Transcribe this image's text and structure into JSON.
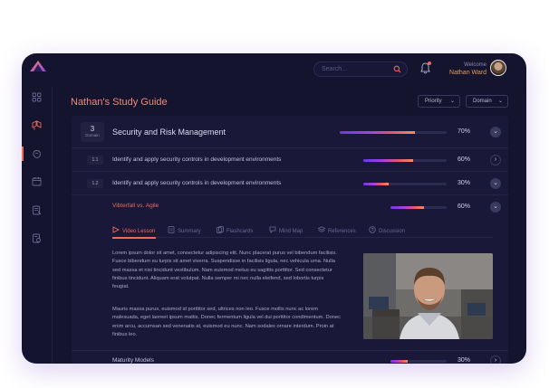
{
  "header": {
    "search_placeholder": "Search...",
    "welcome": "Welcome",
    "user_name": "Nathan Ward"
  },
  "page": {
    "title": "Nathan's Study Guide",
    "filter_priority": "Priority",
    "filter_domain": "Domain"
  },
  "domain": {
    "number": "3",
    "number_label": "Domain",
    "title": "Security and Risk Management",
    "progress_pct": 70,
    "progress_text": "70%"
  },
  "subtopics": [
    {
      "num": "1.1",
      "label": "Identify and apply security controls in development environments",
      "progress_pct": 60,
      "progress_text": "60%"
    },
    {
      "num": "1.2",
      "label": "Identify and apply security controls in development environments",
      "progress_pct": 30,
      "progress_text": "30%"
    }
  ],
  "lesson": {
    "title": "Vibterfall vs. Agile",
    "progress_pct": 60,
    "progress_text": "60%"
  },
  "tabs": [
    {
      "label": "Video Lesson",
      "icon": "play-icon",
      "active": true
    },
    {
      "label": "Summary",
      "icon": "document-icon",
      "active": false
    },
    {
      "label": "Flashcards",
      "icon": "cards-icon",
      "active": false
    },
    {
      "label": "Mind Map",
      "icon": "chat-icon",
      "active": false
    },
    {
      "label": "References",
      "icon": "stack-icon",
      "active": false
    },
    {
      "label": "Discussion",
      "icon": "discussion-icon",
      "active": false
    }
  ],
  "content": {
    "paragraph1": "Lorem ipsum dolor sit amet, consectetur adipiscing elit. Nunc placerat purus vel bibendum facilisis. Fusce bibendum eu turpis sit amet viverra. Suspendisse in facilisis ligula, nec vehicula urna. Nulla sed massa et nisi tincidunt vestibulum. Nam euismod metus eu sagittis porttitor. Sed consectetur finibus tincidunt. Aliquam erat volutpat. Nulla semper mi nec nulla eleifend, sed lobortis turpis feugiat.",
    "paragraph2": "Mauris massa purus, euismod id porttitor sed, ultrices non leo. Fusce mollis nunc ac lorem malesuada, eget laoreet ipsum mattis. Donec fermentum ligula vel dui porttitor condimentum. Donec enim arcu, accumsan sed venenatis at, euismod eu nunc. Nam sodales ornare interdum. Proin at finibus leo."
  },
  "next_lesson": {
    "title": "Maturity Models",
    "progress_pct": 30,
    "progress_text": "30%"
  },
  "colors": {
    "background": "#15142f",
    "accent": "#ef6a5a",
    "gradient_start": "#6c39e6",
    "gradient_end": "#f48a5e"
  }
}
